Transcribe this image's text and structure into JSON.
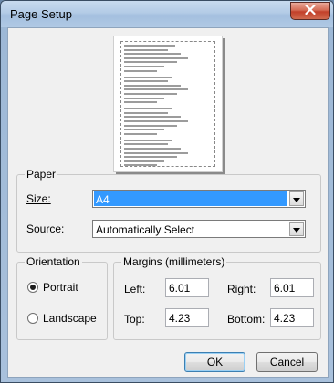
{
  "window": {
    "title": "Page Setup"
  },
  "paper": {
    "group_label": "Paper",
    "size_label": "Size:",
    "size_value": "A4",
    "source_label": "Source:",
    "source_value": "Automatically Select"
  },
  "orientation": {
    "group_label": "Orientation",
    "portrait_label": "Portrait",
    "landscape_label": "Landscape",
    "selected": "Portrait"
  },
  "margins": {
    "group_label": "Margins (millimeters)",
    "left_label": "Left:",
    "left_value": "6.01",
    "right_label": "Right:",
    "right_value": "6.01",
    "top_label": "Top:",
    "top_value": "4.23",
    "bottom_label": "Bottom:",
    "bottom_value": "4.23"
  },
  "buttons": {
    "ok_label": "OK",
    "cancel_label": "Cancel"
  },
  "icons": {
    "close": "close-icon",
    "dropdown": "chevron-down-icon"
  },
  "colors": {
    "selection": "#3399ff",
    "close_button": "#c2402a"
  }
}
